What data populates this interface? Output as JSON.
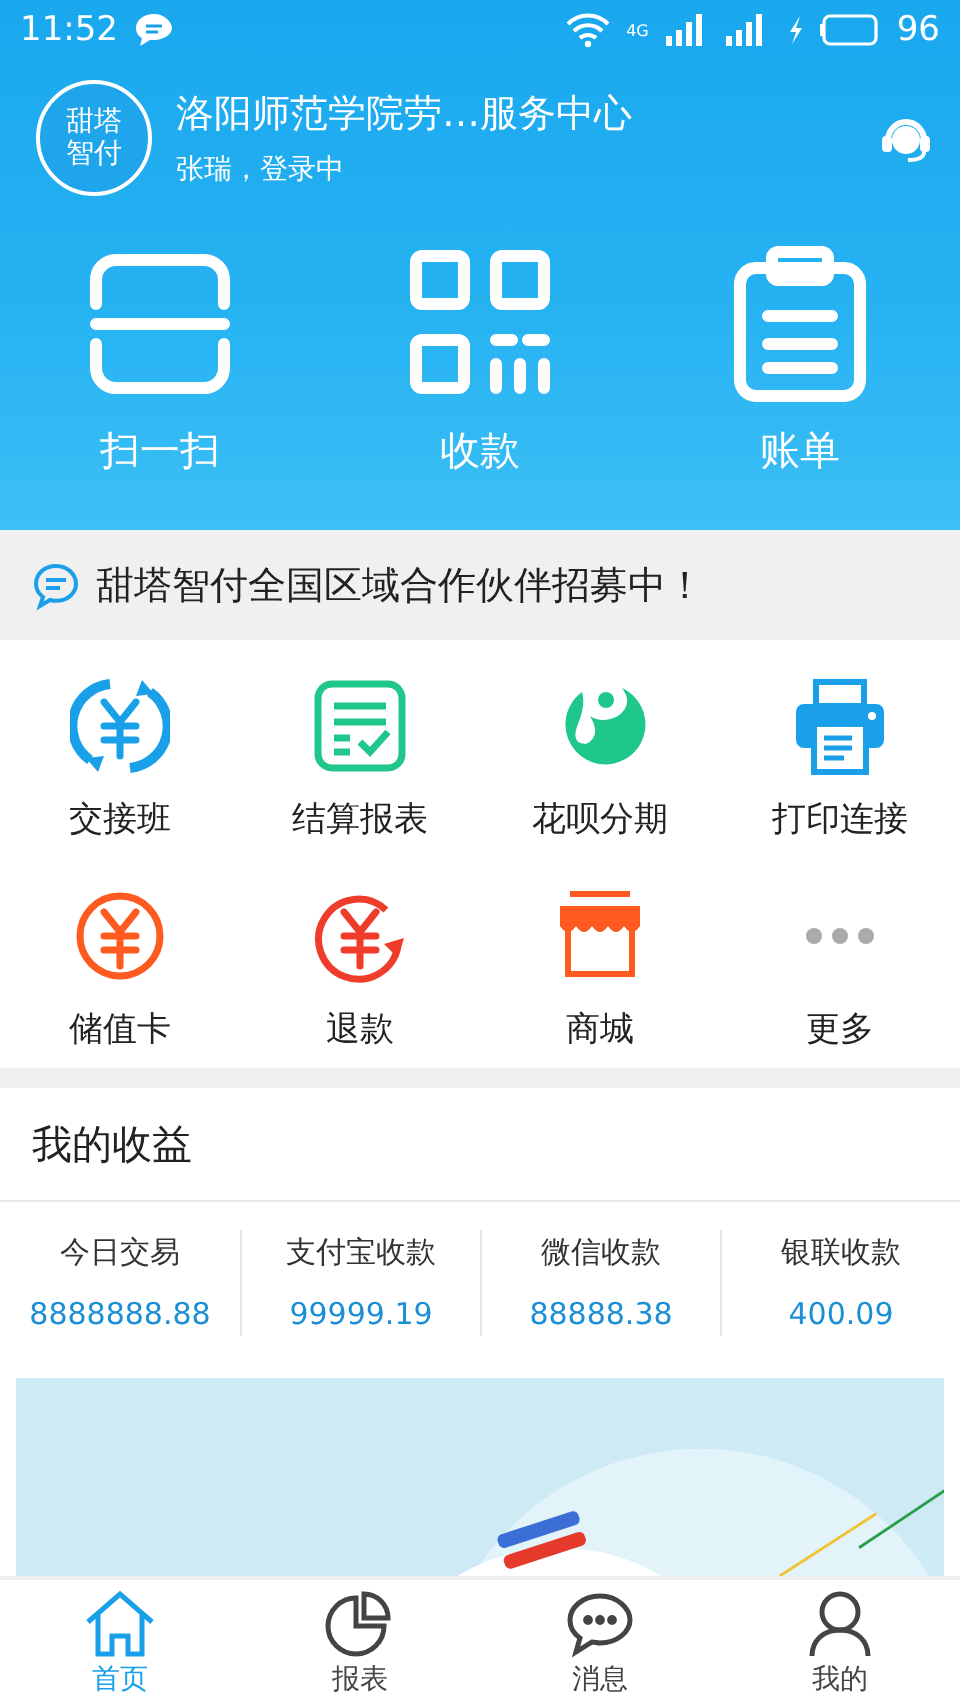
{
  "status_bar": {
    "time": "11:52",
    "network": "4G",
    "battery": "96"
  },
  "header": {
    "avatar_lines": [
      "甜塔",
      "智付"
    ],
    "title": "洛阳师范学院劳…服务中心",
    "subtitle": "张瑞，登录中"
  },
  "actions": [
    {
      "kind": "scan",
      "label": "扫一扫"
    },
    {
      "kind": "qr",
      "label": "收款"
    },
    {
      "kind": "bill",
      "label": "账单"
    }
  ],
  "notice": "甜塔智付全国区域合作伙伴招募中！",
  "grid": [
    {
      "kind": "shift",
      "label": "交接班"
    },
    {
      "kind": "report",
      "label": "结算报表"
    },
    {
      "kind": "huabei",
      "label": "花呗分期"
    },
    {
      "kind": "printer",
      "label": "打印连接"
    },
    {
      "kind": "card",
      "label": "储值卡"
    },
    {
      "kind": "refund",
      "label": "退款"
    },
    {
      "kind": "shop",
      "label": "商城"
    },
    {
      "kind": "more",
      "label": "更多"
    }
  ],
  "earnings": {
    "title": "我的收益",
    "columns": [
      {
        "label": "今日交易",
        "value": "8888888.88"
      },
      {
        "label": "支付宝收款",
        "value": "99999.19"
      },
      {
        "label": "微信收款",
        "value": "88888.38"
      },
      {
        "label": "银联收款",
        "value": "400.09"
      }
    ]
  },
  "nav": [
    {
      "kind": "home",
      "label": "首页",
      "selected": true
    },
    {
      "kind": "pie",
      "label": "报表",
      "selected": false
    },
    {
      "kind": "chat",
      "label": "消息",
      "selected": false
    },
    {
      "kind": "user",
      "label": "我的",
      "selected": false
    }
  ]
}
